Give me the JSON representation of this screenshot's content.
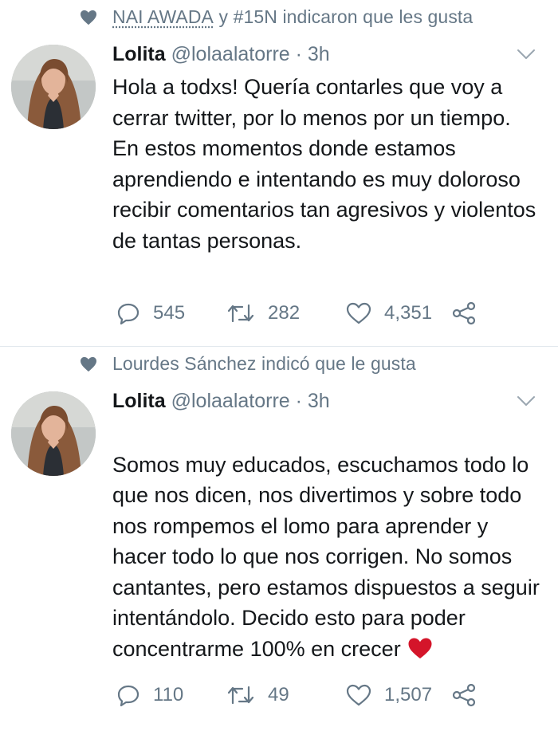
{
  "colors": {
    "text": "#14171a",
    "muted": "#657786",
    "divider": "#e1e8ed",
    "red_heart": "#d4152a"
  },
  "tweets": [
    {
      "social_context": "NAI AWADA y #15N indicaron que les gusta",
      "social_name_part": "NAI AWADA",
      "social_rest": " y #15N indicaron que les gusta",
      "author": "Lolita",
      "handle": "@lolaalatorre",
      "separator": " · ",
      "time": "3h",
      "text": "Hola a todxs! Quería contarles que voy a cerrar twitter, por lo menos por un tiempo. En estos momentos donde estamos aprendiendo e intentando es muy doloroso recibir comentarios tan agresivos y violentos de tantas personas.",
      "replies": "545",
      "retweets": "282",
      "likes": "4,351"
    },
    {
      "social_context": "Lourdes Sánchez indicó que le gusta",
      "author": "Lolita",
      "handle": "@lolaalatorre",
      "separator": " · ",
      "time": "3h",
      "text": "Somos muy educados, escuchamos todo lo que nos dicen, nos divertimos y sobre todo nos rompemos el lomo para aprender y hacer todo lo que nos corrigen. No somos cantantes, pero estamos dispuestos a seguir intentándolo. Decido esto para poder concentrarme 100% en crecer",
      "emoji": "red-heart-emoji",
      "replies": "110",
      "retweets": "49",
      "likes": "1,507"
    }
  ],
  "icons": [
    "heart-icon",
    "chevron-down-icon",
    "reply-icon",
    "retweet-icon",
    "like-icon",
    "share-icon"
  ]
}
